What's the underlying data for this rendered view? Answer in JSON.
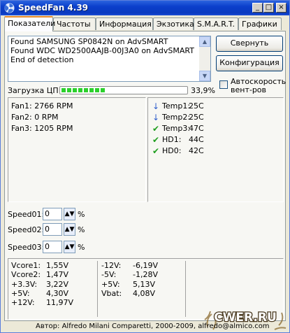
{
  "window": {
    "title": "SpeedFan 4.39"
  },
  "titlebar_buttons": [
    "_",
    "□",
    "×"
  ],
  "tabs": [
    {
      "label": "Показатели"
    },
    {
      "label": "Частоты"
    },
    {
      "label": "Информация"
    },
    {
      "label": "Экзотика"
    },
    {
      "label": "S.M.A.R.T."
    },
    {
      "label": "Графики"
    }
  ],
  "log": {
    "lines": [
      "Found SAMSUNG SP0842N on AdvSMART",
      "Found WDC WD2500AAJB-00J3A0 on AdvSMART",
      "End of detection"
    ]
  },
  "buttons": {
    "minimize": "Свернуть",
    "config": "Конфигурация"
  },
  "checkbox": {
    "label": "Автоскорость вент-ров",
    "checked": false
  },
  "cpu": {
    "label": "Загрузка ЦП",
    "value_text": "33,9%",
    "fraction": 0.339
  },
  "fans": [
    {
      "text": "Fan1: 2766 RPM"
    },
    {
      "text": "Fan2: 0 RPM"
    },
    {
      "text": "Fan3: 1205 RPM"
    }
  ],
  "temps": [
    {
      "name": "Temp1:",
      "value": "25C",
      "icon": "arrow-down-icon"
    },
    {
      "name": "Temp2:",
      "value": "25C",
      "icon": "arrow-down-icon"
    },
    {
      "name": "Temp3:",
      "value": "47C",
      "icon": "checkmark-icon"
    },
    {
      "name": "HD1:",
      "value": "44C",
      "icon": "checkmark-icon"
    },
    {
      "name": "HD0:",
      "value": "42C",
      "icon": "checkmark-icon"
    }
  ],
  "speeds": [
    {
      "label": "Speed01:",
      "value": "0",
      "unit": "%"
    },
    {
      "label": "Speed02:",
      "value": "0",
      "unit": "%"
    },
    {
      "label": "Speed03:",
      "value": "0",
      "unit": "%"
    }
  ],
  "voltages_left": [
    {
      "name": "Vcore1:",
      "value": "1,55V"
    },
    {
      "name": "Vcore2:",
      "value": "1,47V"
    },
    {
      "name": "+3.3V:",
      "value": "3,22V"
    },
    {
      "name": "+5V:",
      "value": "4,30V"
    },
    {
      "name": "+12V:",
      "value": "11,97V"
    }
  ],
  "voltages_right": [
    {
      "name": "-12V:",
      "value": "-6,19V"
    },
    {
      "name": "-5V:",
      "value": "-1,28V"
    },
    {
      "name": "+5V:",
      "value": "5,13V"
    },
    {
      "name": "Vbat:",
      "value": "4,08V"
    }
  ],
  "status": {
    "text": "Автор: Alfredo Milani Comparetti, 2000-2009, alfredo@almico.com"
  },
  "watermark": {
    "text": "CWER.RU"
  },
  "colors": {
    "titlebar": "#0A3AC0",
    "cpu_bar": "#2CD02C",
    "arrow": "#2F5ECC",
    "check": "#1E9E1E"
  }
}
